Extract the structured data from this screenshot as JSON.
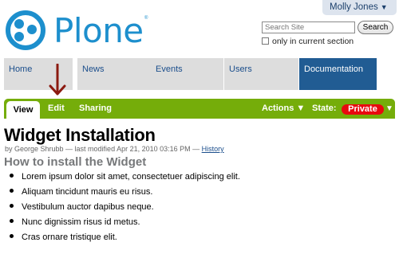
{
  "user_menu": {
    "name": "Molly Jones",
    "arrow": "▼"
  },
  "logo": {
    "text": "Plone",
    "registered": "®"
  },
  "search": {
    "placeholder": "Search Site",
    "button_label": "Search",
    "current_section_label": "only in current section"
  },
  "global_nav": {
    "tabs": [
      {
        "label": "Home"
      },
      {
        "label": "News"
      },
      {
        "label": "Events"
      },
      {
        "label": "Users"
      },
      {
        "label": "Documentation",
        "selected": true
      }
    ]
  },
  "content_views": {
    "view": "View",
    "edit": "Edit",
    "sharing": "Sharing",
    "actions": "Actions ▼",
    "state_label": "State:",
    "state_value": "Private",
    "state_arrow": "▼"
  },
  "annotation": {
    "arrow_color": "#8b1a10"
  },
  "content": {
    "title": "Widget Installation",
    "byline_prefix": "by George Shrubb — last modified Apr 21, 2010 03:16 PM — ",
    "history_link": "History",
    "heading": "How to install the Widget",
    "bullets": [
      "Lorem ipsum dolor sit amet, consectetuer adipiscing elit.",
      "Aliquam tincidunt mauris eu risus.",
      "Vestibulum auctor dapibus neque.",
      "Nunc dignissim risus id metus.",
      "Cras ornare tristique elit."
    ]
  },
  "colors": {
    "brand_blue": "#1d8fcd",
    "nav_selected": "#215c93",
    "content_bar_green": "#75ad0a",
    "private_red": "#e8090f"
  }
}
